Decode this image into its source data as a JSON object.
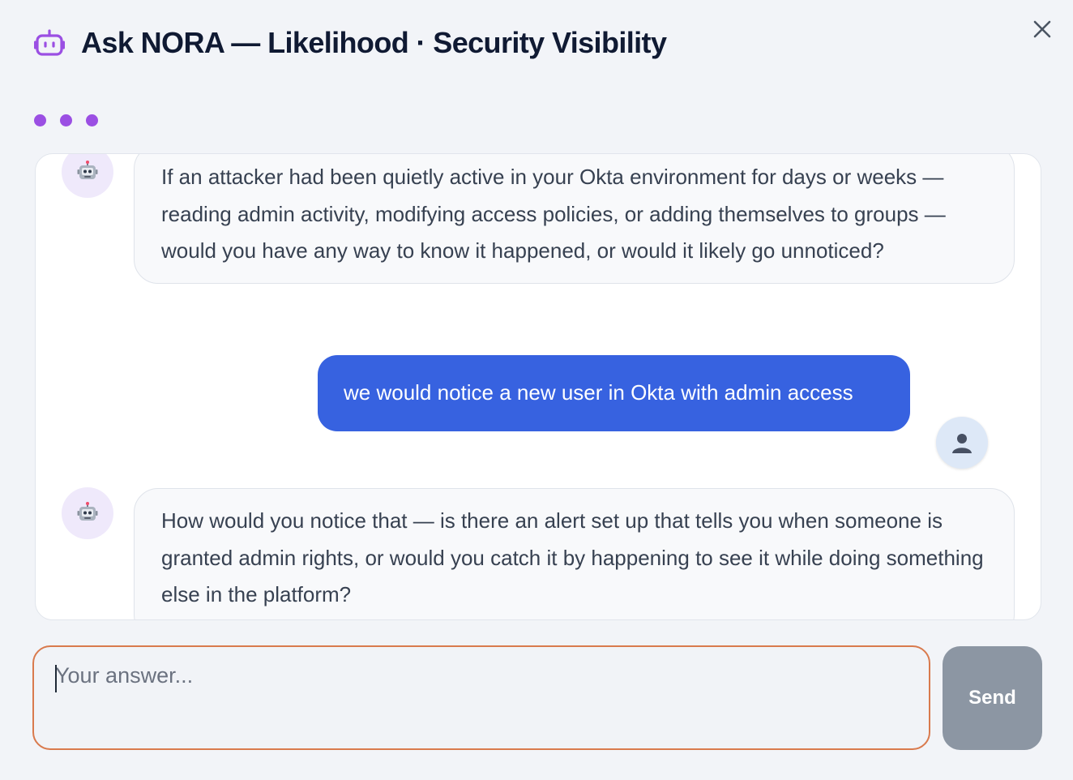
{
  "header": {
    "icon": "robot-icon",
    "title": "Ask NORA — Likelihood · Security Visibility"
  },
  "close": {
    "icon": "close-icon"
  },
  "status": {
    "typing_indicator": "typing-dots",
    "dot_color": "#9b4fe3"
  },
  "messages": [
    {
      "role": "assistant",
      "avatar": "robot-avatar-icon",
      "text": "If an attacker had been quietly active in your Okta environment for days or weeks — reading admin activity, modifying access policies, or adding themselves to groups — would you have any way to know it happened, or would it likely go unnoticed?"
    },
    {
      "role": "user",
      "avatar": "user-avatar-icon",
      "text": "we would notice a new user in Okta with admin access"
    },
    {
      "role": "assistant",
      "avatar": "robot-avatar-icon",
      "text": "How would you notice that — is there an alert set up that tells you when someone is granted admin rights, or would you catch it by happening to see it while doing something else in the platform?"
    }
  ],
  "composer": {
    "placeholder": "Your answer...",
    "value": "",
    "send_label": "Send"
  },
  "colors": {
    "accent_purple": "#9b4fe3",
    "user_bubble": "#3762e0",
    "send_disabled": "#8c96a3",
    "input_focus_border": "#d97a4d"
  }
}
